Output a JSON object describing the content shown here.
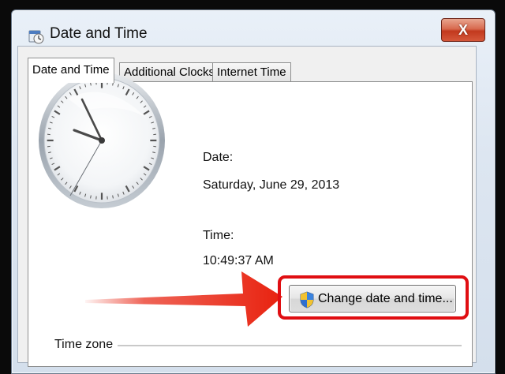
{
  "window": {
    "title": "Date and Time",
    "close_symbol": "X"
  },
  "tabs": [
    {
      "label": "Date and Time",
      "active": true
    },
    {
      "label": "Additional Clocks",
      "active": false
    },
    {
      "label": "Internet Time",
      "active": false
    }
  ],
  "date": {
    "label": "Date:",
    "value": "Saturday, June 29, 2013"
  },
  "time": {
    "label": "Time:",
    "value": "10:49:37 AM"
  },
  "change_button": {
    "label": "Change date and time...",
    "icon": "uac-shield-icon"
  },
  "timezone": {
    "label": "Time zone"
  },
  "colors": {
    "highlight": "#e00e12",
    "arrow": "#e8220f"
  }
}
